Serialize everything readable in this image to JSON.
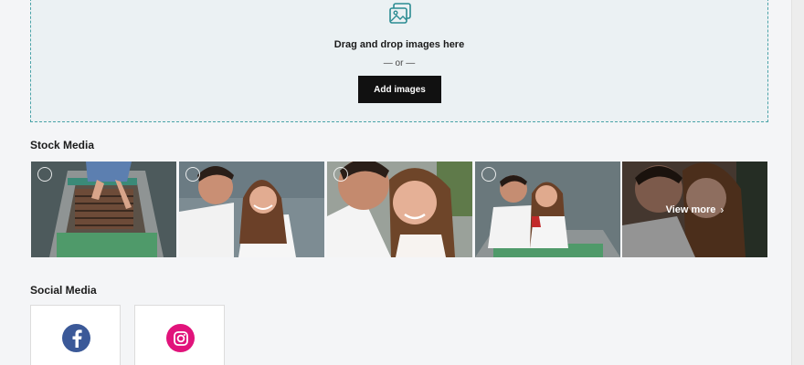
{
  "dropzone": {
    "icon": "image-upload-icon",
    "title": "Drag and drop images here",
    "or_text": "— or —",
    "button_label": "Add images",
    "accent_color": "#4aa3a8"
  },
  "stock_media": {
    "title": "Stock Media",
    "thumbnails": [
      {
        "name": "stock-image-rowboat-feet",
        "icon": "select-circle-icon"
      },
      {
        "name": "stock-image-couple-smiling",
        "icon": "select-circle-icon"
      },
      {
        "name": "stock-image-couple-closeup",
        "icon": "select-circle-icon"
      },
      {
        "name": "stock-image-couple-kissing-boat",
        "icon": "select-circle-icon"
      }
    ],
    "view_more_label": "View more",
    "view_more_icon": "chevron-right-icon"
  },
  "social_media": {
    "title": "Social Media",
    "items": [
      {
        "name": "facebook",
        "icon": "facebook-icon",
        "color": "#3b5998"
      },
      {
        "name": "instagram",
        "icon": "instagram-icon",
        "color": "#e1137b"
      }
    ]
  }
}
